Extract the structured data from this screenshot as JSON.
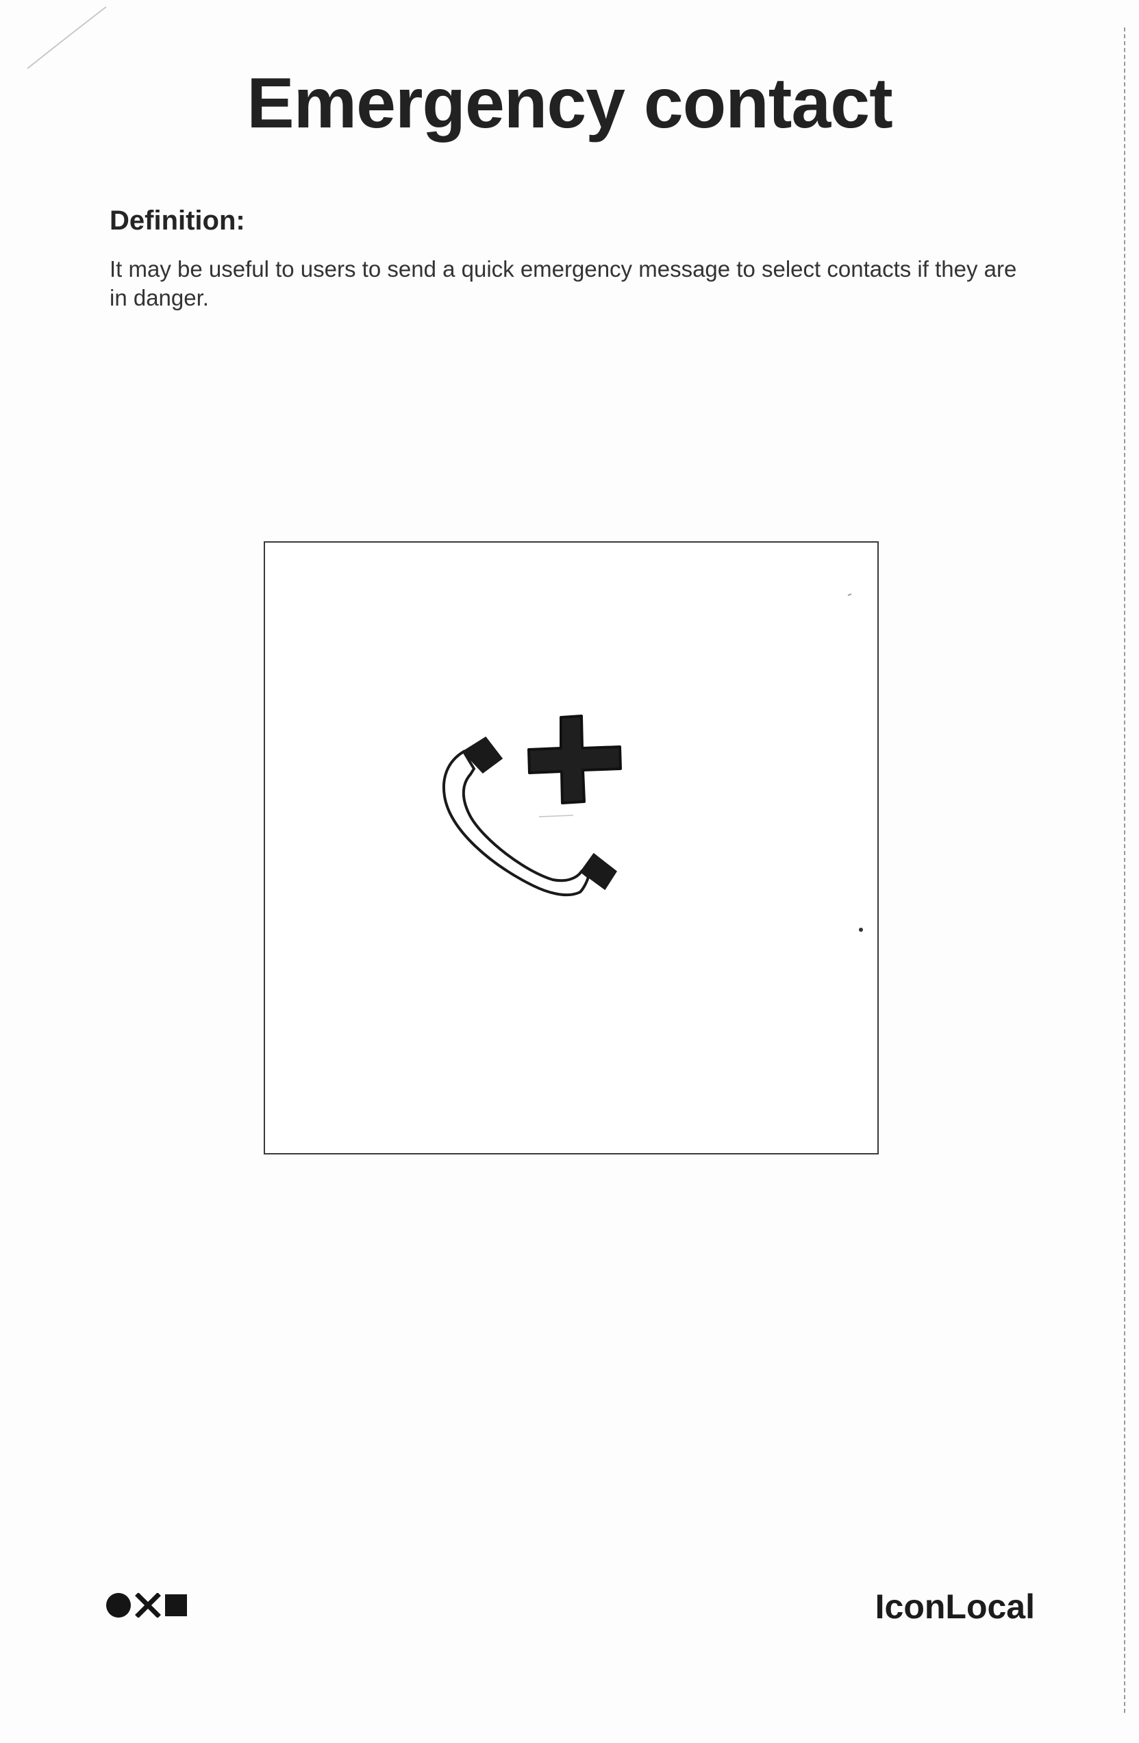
{
  "header": {
    "title": "Emergency contact"
  },
  "definition": {
    "heading": "Definition:",
    "text": "It may be useful to users to send a quick emergency message to select contacts if they are in danger."
  },
  "sketch": {
    "icon_names": [
      "phone-handset-icon",
      "medical-cross-icon"
    ]
  },
  "footer": {
    "brand_icons": [
      "circle-icon",
      "x-icon",
      "square-icon"
    ],
    "brand_name": "IconLocal"
  },
  "colors": {
    "ink": "#1b1b1b",
    "paper": "#fdfdfd",
    "frame": "#3a3a3a"
  }
}
